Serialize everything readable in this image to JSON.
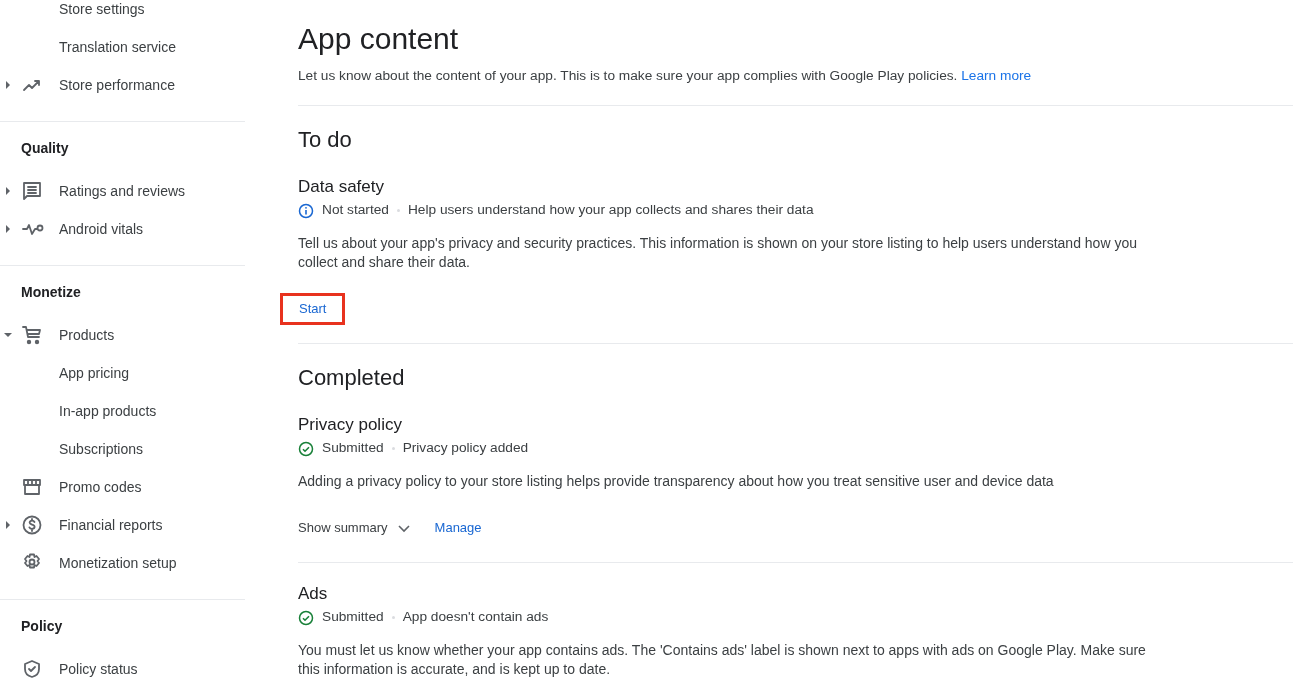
{
  "sidebar": {
    "sections": [
      {
        "items": [
          {
            "kind": "subitem",
            "label": "Store settings"
          },
          {
            "kind": "subitem",
            "label": "Translation service"
          },
          {
            "kind": "item",
            "label": "Store performance",
            "expanded": false
          }
        ]
      },
      {
        "title": "Quality",
        "items": [
          {
            "kind": "item",
            "label": "Ratings and reviews",
            "expanded": false
          },
          {
            "kind": "item",
            "label": "Android vitals",
            "expanded": false
          }
        ]
      },
      {
        "title": "Monetize",
        "items": [
          {
            "kind": "item",
            "label": "Products",
            "expanded": true
          },
          {
            "kind": "subitem",
            "label": "App pricing"
          },
          {
            "kind": "subitem",
            "label": "In-app products"
          },
          {
            "kind": "subitem",
            "label": "Subscriptions"
          },
          {
            "kind": "leaf",
            "label": "Promo codes"
          },
          {
            "kind": "item",
            "label": "Financial reports",
            "expanded": false
          },
          {
            "kind": "leaf",
            "label": "Monetization setup"
          }
        ]
      },
      {
        "title": "Policy",
        "items": [
          {
            "kind": "leaf",
            "label": "Policy status"
          }
        ]
      }
    ]
  },
  "main": {
    "title": "App content",
    "subtitle": "Let us know about the content of your app. This is to make sure your app complies with Google Play policies.",
    "learn_more": "Learn more",
    "groups": [
      {
        "heading": "To do",
        "tasks": [
          {
            "title": "Data safety",
            "status": {
              "kind": "info",
              "label": "Not started"
            },
            "summary": "Help users understand how your app collects and shares their data",
            "description": "Tell us about your app's privacy and security practices. This information is shown on your store listing to help users understand how you collect and share their data.",
            "actions": [
              {
                "kind": "link",
                "label": "Start",
                "highlighted": true
              }
            ]
          }
        ]
      },
      {
        "heading": "Completed",
        "tasks": [
          {
            "title": "Privacy policy",
            "status": {
              "kind": "done",
              "label": "Submitted"
            },
            "summary": "Privacy policy added",
            "description": "Adding a privacy policy to your store listing helps provide transparency about how you treat sensitive user and device data",
            "actions": [
              {
                "kind": "toggle",
                "label": "Show summary"
              },
              {
                "kind": "link",
                "label": "Manage",
                "highlighted": false
              }
            ]
          },
          {
            "title": "Ads",
            "status": {
              "kind": "done",
              "label": "Submitted"
            },
            "summary": "App doesn't contain ads",
            "description": "You must let us know whether your app contains ads. The 'Contains ads' label is shown next to apps with ads on Google Play. Make sure this information is accurate, and is kept up to date."
          }
        ]
      }
    ]
  }
}
